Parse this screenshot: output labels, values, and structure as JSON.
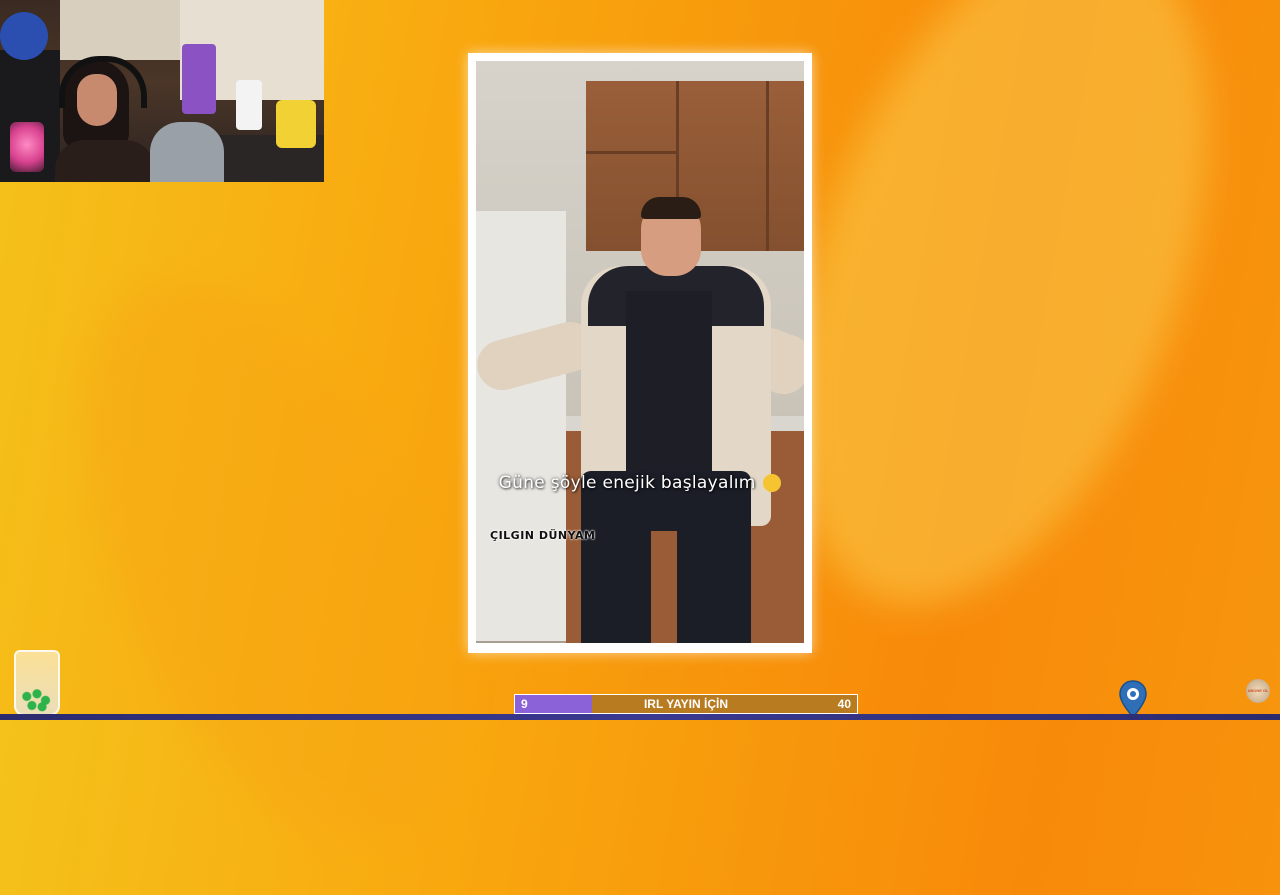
{
  "video": {
    "caption": "Güne şöyle enejik başlayalım",
    "caption_emoji": "laughing-face-emoji",
    "watermark": "ÇILGIN DÜNYAM"
  },
  "goal_bar": {
    "current": "9",
    "label": "IRL YAYIN İÇİN",
    "target": "40",
    "progress": 0.225,
    "fill_color": "#8c62d8",
    "track_color": "#b97b20"
  },
  "overlay": {
    "subscribe_logo_text": "ABONE OL",
    "pin_icon": "location-pin-icon",
    "jar_icon": "jar-icon"
  },
  "colors": {
    "background_start": "#f4c21a",
    "background_end": "#f88a0a",
    "frame_border": "#ffffff",
    "bottom_strip": "#3a3990"
  }
}
